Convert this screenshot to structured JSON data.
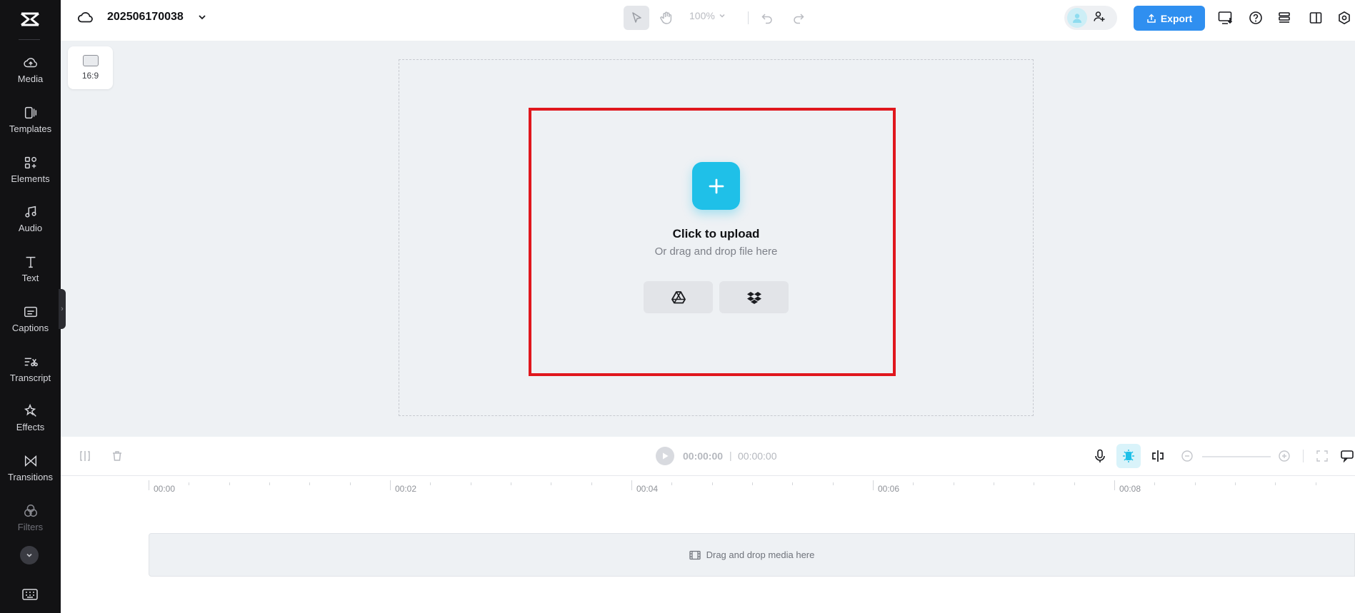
{
  "project": {
    "title": "202506170038"
  },
  "sidebar": {
    "items": [
      {
        "label": "Media",
        "icon": "cloud-upload-icon"
      },
      {
        "label": "Templates",
        "icon": "templates-icon"
      },
      {
        "label": "Elements",
        "icon": "elements-icon"
      },
      {
        "label": "Audio",
        "icon": "music-note-icon"
      },
      {
        "label": "Text",
        "icon": "text-icon"
      },
      {
        "label": "Captions",
        "icon": "captions-icon"
      },
      {
        "label": "Transcript",
        "icon": "transcript-icon"
      },
      {
        "label": "Effects",
        "icon": "effects-icon"
      },
      {
        "label": "Transitions",
        "icon": "transitions-icon"
      },
      {
        "label": "Filters",
        "icon": "filters-icon"
      }
    ]
  },
  "toolbar": {
    "zoom": "100%",
    "export_label": "Export"
  },
  "canvas": {
    "ratio_label": "16:9",
    "upload_title": "Click to upload",
    "upload_subtitle": "Or drag and drop file here"
  },
  "timeline": {
    "current_time": "00:00:00",
    "separator": "|",
    "total_time": "00:00:00",
    "ruler": [
      "00:00",
      "00:02",
      "00:04",
      "00:06",
      "00:08"
    ],
    "track_placeholder": "Drag and drop media here"
  },
  "colors": {
    "accent": "#2f8ff0",
    "upload_button": "#1fc0e8",
    "highlight_border": "#e0171d",
    "sidebar_bg": "#121214"
  }
}
